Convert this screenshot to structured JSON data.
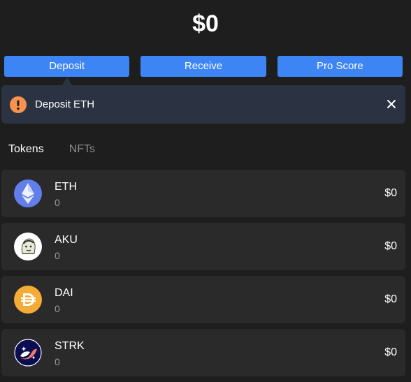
{
  "balance": {
    "total": "$0"
  },
  "actions": {
    "deposit_label": "Deposit",
    "receive_label": "Receive",
    "pro_score_label": "Pro Score"
  },
  "notice": {
    "text": "Deposit ETH",
    "icon": "exclamation-icon",
    "icon_color": "#f7934c"
  },
  "tabs": {
    "tokens_label": "Tokens",
    "nfts_label": "NFTs"
  },
  "tokens": [
    {
      "symbol": "ETH",
      "amount": "0",
      "value": "$0",
      "icon": "eth-logo-icon"
    },
    {
      "symbol": "AKU",
      "amount": "0",
      "value": "$0",
      "icon": "aku-logo-icon"
    },
    {
      "symbol": "DAI",
      "amount": "0",
      "value": "$0",
      "icon": "dai-logo-icon"
    },
    {
      "symbol": "STRK",
      "amount": "0",
      "value": "$0",
      "icon": "strk-logo-icon"
    }
  ],
  "colors": {
    "background": "#1e1e1e",
    "accent": "#3d85f5",
    "notice_bg": "#2b3342",
    "row_bg": "#2a2a2a"
  }
}
